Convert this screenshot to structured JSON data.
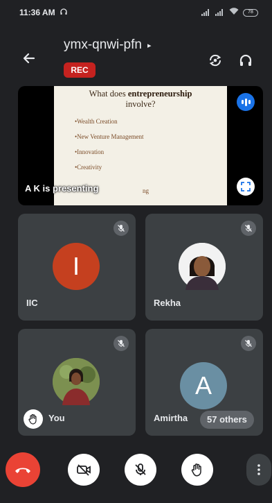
{
  "status_bar": {
    "time": "11:36 AM",
    "battery": "78"
  },
  "header": {
    "meeting_code": "ymx-qnwi-pfn",
    "code_caret": "▸",
    "rec_label": "REC"
  },
  "presentation": {
    "slide_title_prefix": "What does",
    "slide_title_bold": "entrepreneurship",
    "slide_title_suffix": "involve?",
    "slide_items": [
      "•Wealth Creation",
      "•New Venture Management",
      "•Innovation",
      "•Creativity"
    ],
    "slide_partial": "ng",
    "presenter_label": "A K is presenting"
  },
  "participants": [
    {
      "name": "IIC",
      "initial": "I",
      "avatar_color": "#c5401f",
      "muted": true
    },
    {
      "name": "Rekha",
      "muted": true
    },
    {
      "name": "You",
      "muted": true,
      "hand_raised": true
    },
    {
      "name": "Amirtha",
      "initial": "A",
      "avatar_color": "#6a8fa3",
      "muted": true
    }
  ],
  "others_chip": "57 others",
  "controls": {
    "end_call": "end-call",
    "camera": "camera-off",
    "mic": "mic-off",
    "hand": "raise-hand",
    "more": "more-options"
  },
  "colors": {
    "background": "#202124",
    "tile": "#3c4043",
    "end_call": "#ea4335",
    "rec": "#c5221f",
    "audio_indicator": "#1a73e8"
  }
}
